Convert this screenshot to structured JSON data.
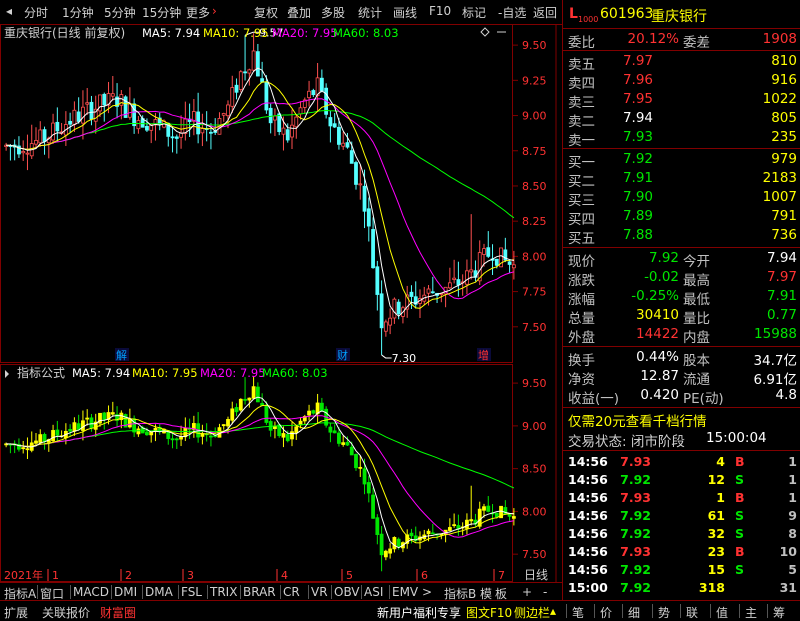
{
  "toolbar": {
    "left": [
      "分时",
      "1分钟",
      "5分钟",
      "15分钟",
      "更多"
    ],
    "more_arrow": "›",
    "right": [
      "复权",
      "叠加",
      "多股",
      "统计",
      "画线",
      "F10",
      "标记",
      "-自选",
      "返回"
    ]
  },
  "main_chart": {
    "title": "重庆银行(日线 前复权)",
    "ma_labels": [
      {
        "text": "MA5: 7.94",
        "color": "#ffffff"
      },
      {
        "text": "MA10: 7.95",
        "color": "#ffff00"
      },
      {
        "text": "MA20: 7.95",
        "color": "#ff00ff"
      },
      {
        "text": "MA60: 8.03",
        "color": "#00ff00"
      }
    ],
    "y_ticks": [
      "9.50",
      "9.25",
      "9.00",
      "8.75",
      "8.50",
      "8.25",
      "8.00",
      "7.75",
      "7.50"
    ],
    "high_marker": "9.57",
    "low_marker": "7.30",
    "event_labels": [
      "解",
      "财",
      "增"
    ],
    "corner_icons": [
      "diamond-icon",
      "minus-icon"
    ]
  },
  "sub_chart": {
    "title": "指标公式",
    "ma_labels": [
      {
        "text": "MA5: 7.94",
        "color": "#ffffff"
      },
      {
        "text": "MA10: 7.95",
        "color": "#ffff00"
      },
      {
        "text": "MA20: 7.95",
        "color": "#ff00ff"
      },
      {
        "text": "MA60: 8.03",
        "color": "#00ff00"
      }
    ],
    "y_ticks": [
      "9.50",
      "9.00",
      "8.50",
      "8.00",
      "7.50"
    ]
  },
  "time_axis": {
    "year": "2021年",
    "months": [
      "1",
      "2",
      "3",
      "4",
      "5",
      "6",
      "7"
    ],
    "period": "日线"
  },
  "indicator_tabs": {
    "items": [
      "指标A",
      "窗口",
      "MACD",
      "DMI",
      "DMA",
      "FSL",
      "TRIX",
      "BRAR",
      "CR",
      "VR",
      "OBV",
      "ASI",
      "EMV"
    ],
    "more_arrow": ">",
    "right": [
      "指标B",
      "模",
      "板",
      "+",
      "-"
    ]
  },
  "bottom_bar": {
    "left": [
      {
        "text": "扩展",
        "color": "#d0d0d0"
      },
      {
        "text": "关联报价",
        "color": "#d0d0d0"
      },
      {
        "text": "财富圈",
        "color": "#ff3232"
      }
    ],
    "middle": [
      {
        "text": "新用户福利专享",
        "color": "#ffffff"
      },
      {
        "text": "图文F10",
        "color": "#ffff00"
      },
      {
        "text": "侧边栏",
        "color": "#ffff00"
      }
    ],
    "right_tabs": [
      "笔",
      "价",
      "细",
      "势",
      "联",
      "值",
      "主",
      "筹"
    ]
  },
  "stock": {
    "level_badge": "L",
    "level_sub": "1000",
    "code": "601963",
    "name": "重庆银行",
    "ratio": [
      {
        "label": "委比",
        "value": "20.12%",
        "label2": "委差",
        "value2": "1908"
      }
    ],
    "asks": [
      {
        "label": "卖五",
        "price": "7.97",
        "vol": "810",
        "color": "#ff3232"
      },
      {
        "label": "卖四",
        "price": "7.96",
        "vol": "916",
        "color": "#ff3232"
      },
      {
        "label": "卖三",
        "price": "7.95",
        "vol": "1022",
        "color": "#ff3232"
      },
      {
        "label": "卖二",
        "price": "7.94",
        "vol": "805",
        "color": "#ffffff"
      },
      {
        "label": "卖一",
        "price": "7.93",
        "vol": "235",
        "color": "#00e600"
      }
    ],
    "bids": [
      {
        "label": "买一",
        "price": "7.92",
        "vol": "979",
        "color": "#00e600"
      },
      {
        "label": "买二",
        "price": "7.91",
        "vol": "2183",
        "color": "#00e600"
      },
      {
        "label": "买三",
        "price": "7.90",
        "vol": "1007",
        "color": "#00e600"
      },
      {
        "label": "买四",
        "price": "7.89",
        "vol": "791",
        "color": "#00e600"
      },
      {
        "label": "买五",
        "price": "7.88",
        "vol": "736",
        "color": "#00e600"
      }
    ],
    "quote": [
      {
        "l1": "现价",
        "v1": "7.92",
        "c1": "#00e600",
        "l2": "今开",
        "v2": "7.94",
        "c2": "#ffffff"
      },
      {
        "l1": "涨跌",
        "v1": "-0.02",
        "c1": "#00e600",
        "l2": "最高",
        "v2": "7.97",
        "c2": "#ff3232"
      },
      {
        "l1": "涨幅",
        "v1": "-0.25%",
        "c1": "#00e600",
        "l2": "最低",
        "v2": "7.91",
        "c2": "#00e600"
      },
      {
        "l1": "总量",
        "v1": "30410",
        "c1": "#ffff00",
        "l2": "量比",
        "v2": "0.77",
        "c2": "#00e600"
      },
      {
        "l1": "外盘",
        "v1": "14422",
        "c1": "#ff3232",
        "l2": "内盘",
        "v2": "15988",
        "c2": "#00e600"
      }
    ],
    "fundamentals": [
      {
        "l1": "换手",
        "v1": "0.44%",
        "l2": "股本",
        "v2": "34.7亿"
      },
      {
        "l1": "净资",
        "v1": "12.87",
        "l2": "流通",
        "v2": "6.91亿"
      },
      {
        "l1": "收益(一)",
        "v1": "0.420",
        "l2": "PE(动)",
        "v2": "4.8"
      }
    ],
    "promo": "仅需20元查看千档行情",
    "trade_status_label": "交易状态: 闭市阶段",
    "trade_status_time": "15:00:04",
    "ticks": [
      {
        "time": "14:56",
        "price": "7.93",
        "vol": "4",
        "side": "B",
        "count": "1",
        "pc": "#ff3232",
        "sc": "#ff3232"
      },
      {
        "time": "14:56",
        "price": "7.92",
        "vol": "12",
        "side": "S",
        "count": "1",
        "pc": "#00e600",
        "sc": "#00e600"
      },
      {
        "time": "14:56",
        "price": "7.93",
        "vol": "1",
        "side": "B",
        "count": "1",
        "pc": "#ff3232",
        "sc": "#ff3232"
      },
      {
        "time": "14:56",
        "price": "7.92",
        "vol": "61",
        "side": "S",
        "count": "9",
        "pc": "#00e600",
        "sc": "#00e600"
      },
      {
        "time": "14:56",
        "price": "7.92",
        "vol": "32",
        "side": "S",
        "count": "8",
        "pc": "#00e600",
        "sc": "#00e600"
      },
      {
        "time": "14:56",
        "price": "7.93",
        "vol": "23",
        "side": "B",
        "count": "10",
        "pc": "#ff3232",
        "sc": "#ff3232"
      },
      {
        "time": "14:56",
        "price": "7.92",
        "vol": "15",
        "side": "S",
        "count": "5",
        "pc": "#00e600",
        "sc": "#00e600"
      },
      {
        "time": "15:00",
        "price": "7.92",
        "vol": "318",
        "side": "",
        "count": "31",
        "pc": "#00e600",
        "sc": "#c0c0c0"
      }
    ]
  },
  "colors": {
    "up": "#ff3232",
    "down": "#00e600",
    "up_candle_main": "#ff5050",
    "down_candle_main": "#54ffff",
    "up_candle_sub": "#ffff00",
    "down_candle_sub": "#00e600",
    "grid": "#800000",
    "ma5": "#ffffff",
    "ma10": "#ffff00",
    "ma20": "#ff00ff",
    "ma60": "#00ff00"
  }
}
